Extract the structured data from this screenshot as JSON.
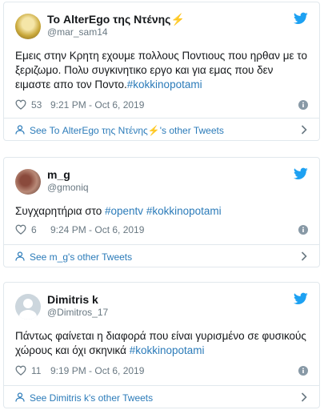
{
  "colors": {
    "link": "#2b7bb9",
    "muted": "#697882",
    "bird": "#1da1f2",
    "border": "#e1e8ed"
  },
  "tweets": [
    {
      "display_name": "Το AlterEgo της Ντένης",
      "name_emoji": "⚡",
      "screen_name": "@mar_sam14",
      "text": "Εμεις στην Κρητη εχουμε πολλους Ποντιους που ηρθαν με το ξεριζωμο. Πολυ συγκινητικο εργο και για εμας που δεν ειμαστε απο τον Ποντο.",
      "hashtags": [
        "#kokkinopotami"
      ],
      "likes": "53",
      "time": "9:21 PM - Oct 6, 2019",
      "see_more": "See Το AlterEgo της Ντένης⚡'s other Tweets"
    },
    {
      "display_name": "m_g",
      "name_emoji": "",
      "screen_name": "@gmoniq",
      "text": "Συγχαρητήρια στο ",
      "hashtags": [
        "#opentv",
        "#kokkinopotami"
      ],
      "likes": "6",
      "time": "9:24 PM - Oct 6, 2019",
      "see_more": "See m_g's other Tweets"
    },
    {
      "display_name": "Dimitris k",
      "name_emoji": "",
      "screen_name": "@Dimitros_17",
      "text": "Πάντως φαίνεται η διαφορά που είναι γυρισμένο σε φυσικούς χώρους και όχι σκηνικά ",
      "hashtags": [
        "#kokkinopotami"
      ],
      "likes": "11",
      "time": "9:19 PM - Oct 6, 2019",
      "see_more": "See Dimitris k's other Tweets"
    }
  ]
}
